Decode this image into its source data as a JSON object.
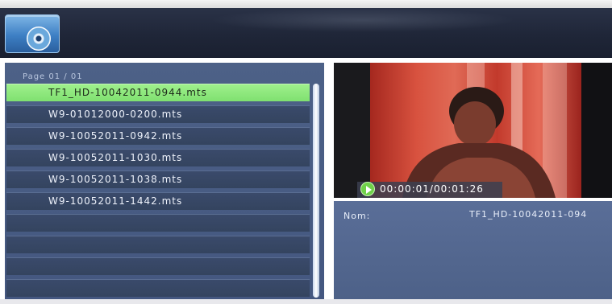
{
  "header": {
    "icon": "media-disc-icon"
  },
  "file_list": {
    "page_label": "Page  01 / 01",
    "items": [
      "TF1_HD-10042011-0944.mts",
      "W9-01012000-0200.mts",
      "W9-10052011-0942.mts",
      "W9-10052011-1030.mts",
      "W9-10052011-1038.mts",
      "W9-10052011-1442.mts",
      "",
      "",
      "",
      ""
    ],
    "selected_index": 0
  },
  "preview": {
    "play_icon": "play-icon",
    "time": "00:00:01/00:01:26"
  },
  "info": {
    "name_label": "Nom:",
    "name_value": "TF1_HD-10042011-094"
  },
  "colors": {
    "selected_row": "#9ff08c",
    "panel": "#4d6187",
    "header": "#1f2638"
  }
}
